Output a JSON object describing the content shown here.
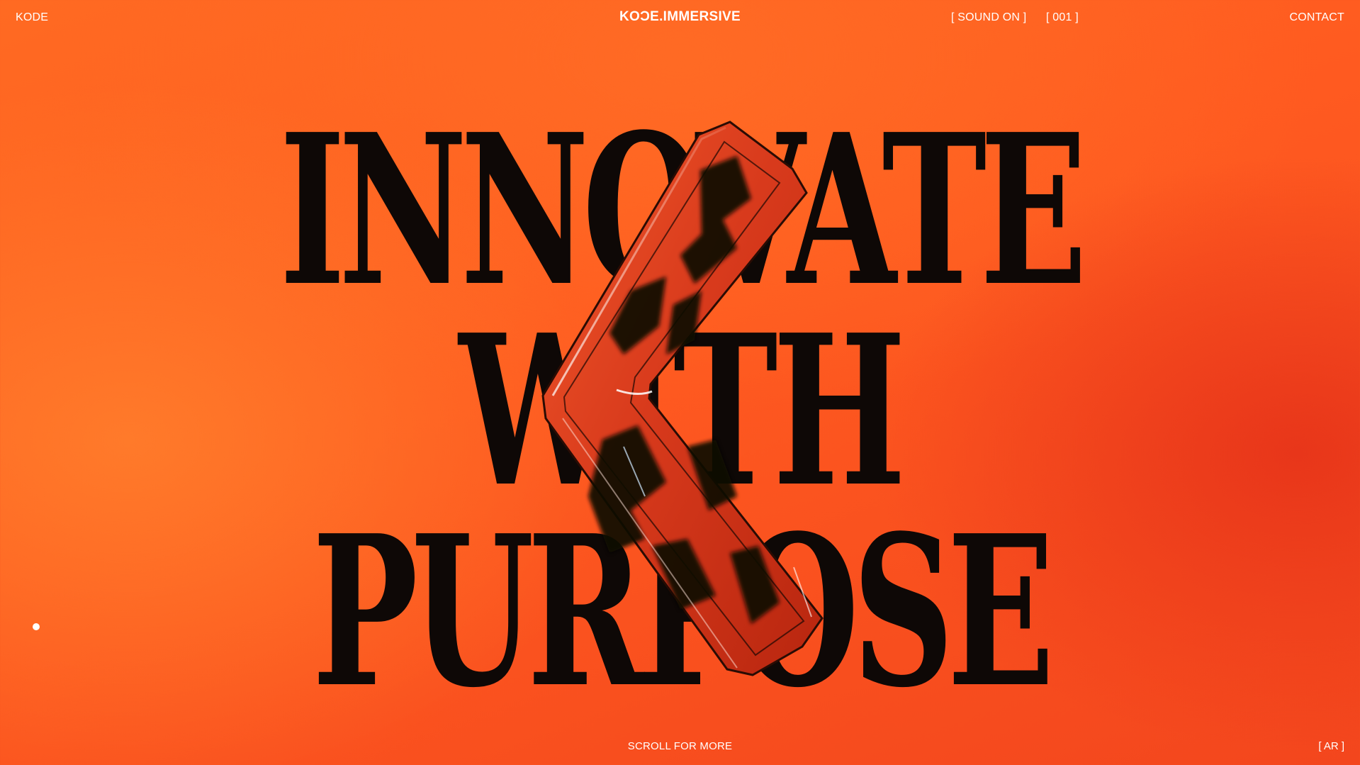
{
  "nav": {
    "brand_left": "KODE",
    "brand_center": "KOƆE.IMMERSIVE",
    "sound_toggle": "[ SOUND ON ]",
    "counter": "[ 001 ]",
    "contact": "CONTACT"
  },
  "hero": {
    "lines": [
      "INNOVATE",
      "WITH",
      "PURPOSE"
    ]
  },
  "footer": {
    "scroll_hint": "SCROLL FOR MORE",
    "language_toggle": "[ AR ]"
  },
  "colors": {
    "background": "#ff5a20",
    "headline": "#0e0806",
    "nav_text": "#ffffff",
    "sculpture_base": "#d83a1c"
  }
}
